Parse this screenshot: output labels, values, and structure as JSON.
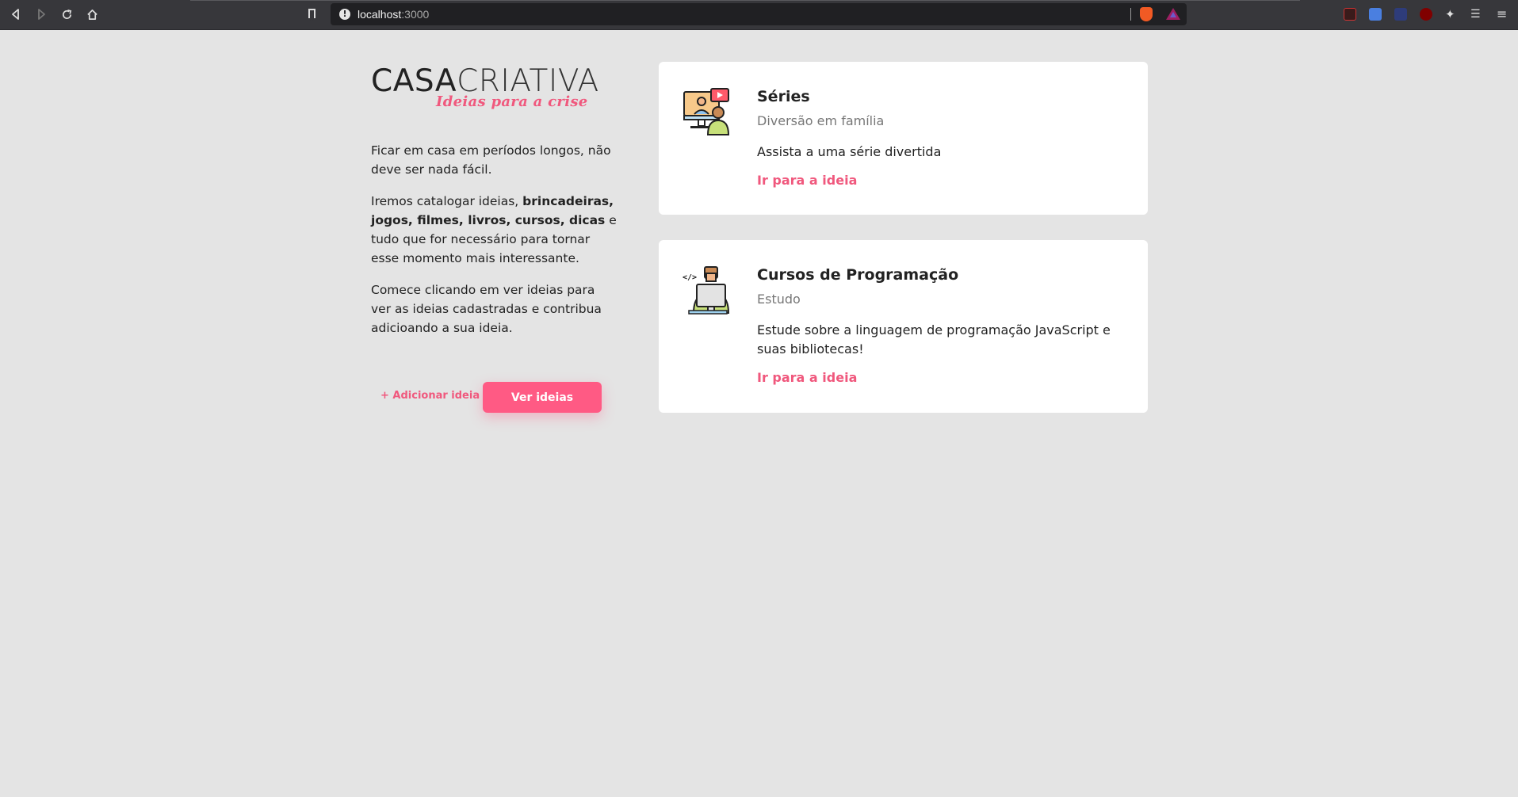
{
  "browser": {
    "url_host": "localhost",
    "url_port": ":3000"
  },
  "brand": {
    "name_bold": "CASA",
    "name_light": "CRIATIVA",
    "tagline": "Ideias para a crise",
    "accent_color": "#f0587d"
  },
  "intro": {
    "p1": "Ficar em casa em períodos longos, não deve ser nada fácil.",
    "p2_start": "Iremos catalogar ideias, ",
    "p2_bold": "brincadeiras, jogos, filmes, livros, cursos, dicas",
    "p2_end": " e tudo que for necessário para tornar esse momento mais interessante.",
    "p3": "Comece clicando em ver ideias para ver as ideias cadastradas e contribua adicioando a sua ideia."
  },
  "actions": {
    "add_label": "+ Adicionar ideia",
    "view_label": "Ver ideias"
  },
  "ideas": [
    {
      "title": "Séries",
      "category": "Diversão em família",
      "description": "Assista a uma série divertida",
      "link_label": "Ir para a ideia",
      "icon": "family-tv-icon"
    },
    {
      "title": "Cursos de Programação",
      "category": "Estudo",
      "description": "Estude sobre a linguagem de programação JavaScript e suas bibliotecas!",
      "link_label": "Ir para a ideia",
      "icon": "programmer-icon"
    }
  ]
}
